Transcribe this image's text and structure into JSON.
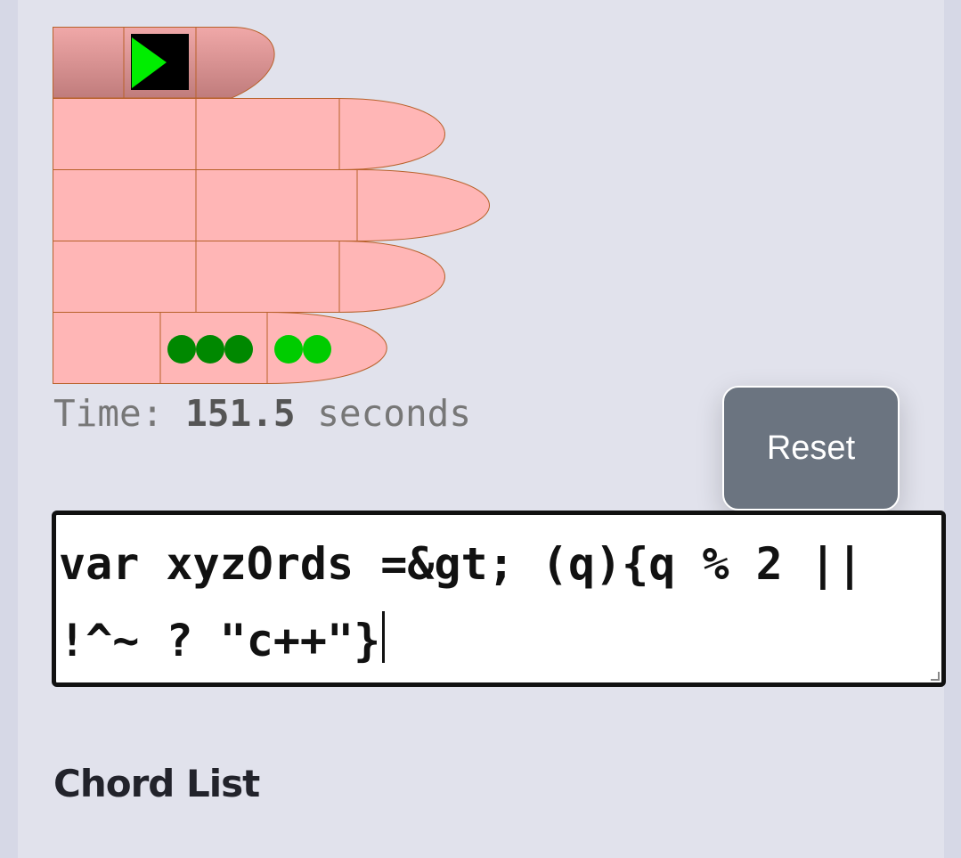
{
  "colors": {
    "skin": "#ffb6b6",
    "skin_outline": "#b8612a",
    "thumb_shade": "#c07c7c",
    "key_dark_green": "#008800",
    "key_bright_green": "#00cc00",
    "play_green": "#00ee00",
    "play_bg": "#000000",
    "button_bg": "#6b7480"
  },
  "hand": {
    "play_icon": "play-triangle-icon",
    "finger5_first_cell_dots": 3,
    "finger5_second_cell_dots": 2
  },
  "timer": {
    "prefix": "Time:",
    "value": "151.5",
    "suffix": "seconds"
  },
  "reset_button": {
    "label": "Reset"
  },
  "editor": {
    "text": "var xyzOrds =&gt; (q){q % 2 || !^~ ? \"c++\"}"
  },
  "chord_list": {
    "heading": "Chord List"
  }
}
